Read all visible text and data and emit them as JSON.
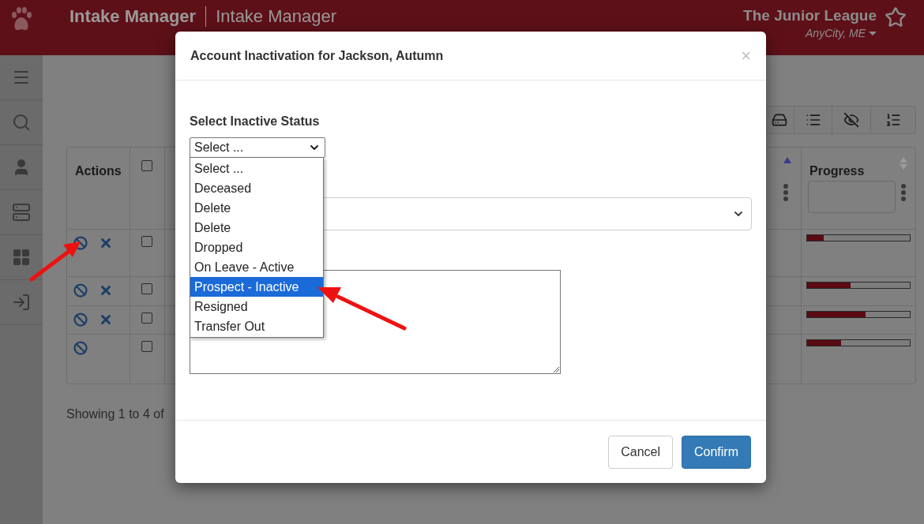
{
  "header": {
    "app_title": "Intake Manager",
    "section_title": "Intake Manager",
    "org_name": "The Junior League",
    "location": "AnyCity, ME"
  },
  "sidebar": {
    "items": [
      {
        "kind": "menu"
      },
      {
        "kind": "search"
      },
      {
        "kind": "user"
      },
      {
        "kind": "server"
      },
      {
        "kind": "grid"
      },
      {
        "kind": "login"
      }
    ]
  },
  "table": {
    "columns": [
      {
        "label": "Actions"
      },
      {
        "label": "Progress"
      }
    ],
    "select_all_checked": false,
    "rows": [
      {
        "checked": false,
        "remove": true,
        "level": 0.16
      },
      {
        "checked": false,
        "remove": true,
        "level": 0.42
      },
      {
        "checked": false,
        "remove": true,
        "level": 0.57
      },
      {
        "checked": false,
        "remove": false,
        "level": 0.33
      }
    ]
  },
  "footer_text": "Showing 1 to 4 of",
  "dialog": {
    "title": "Account Inactivation for Jackson, Autumn",
    "close": "×",
    "status_label": "Select Inactive Status",
    "status_value": "Select ...",
    "options": [
      {
        "label": "Select ...",
        "selected": false
      },
      {
        "label": "Deceased",
        "selected": false
      },
      {
        "label": "Delete",
        "selected": false
      },
      {
        "label": "Delete",
        "selected": false
      },
      {
        "label": "Dropped",
        "selected": false
      },
      {
        "label": "On Leave - Active",
        "selected": false
      },
      {
        "label": "Prospect - Inactive",
        "selected": true
      },
      {
        "label": "Resigned",
        "selected": false
      },
      {
        "label": "Transfer Out",
        "selected": false
      }
    ],
    "buttons": [
      {
        "label": "Cancel",
        "kind": "secondary"
      },
      {
        "label": "Confirm",
        "kind": "primary"
      }
    ]
  }
}
